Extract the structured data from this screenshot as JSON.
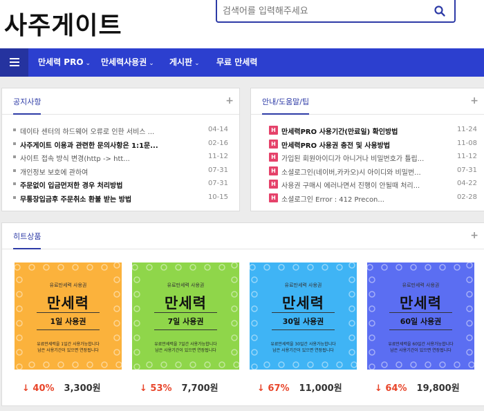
{
  "header": {
    "logo": "사주게이트",
    "search_placeholder": "검색어를 입력해주세요"
  },
  "nav": {
    "items": [
      {
        "label": "만세력 PRO",
        "chevron": "⌄"
      },
      {
        "label": "만세력사용권",
        "chevron": "⌄"
      },
      {
        "label": "게시판",
        "chevron": "⌄"
      },
      {
        "label": "무료 만세력",
        "chevron": ""
      }
    ]
  },
  "notice": {
    "title": "공지사항",
    "plus": "+",
    "items": [
      {
        "text": "데이타 센터의 하드웨어 오류로 인한 서비스 ...",
        "date": "04-14",
        "bold": false
      },
      {
        "text": "사주게이트 이용과 관련한 문의사항은 1:1문...",
        "date": "02-16",
        "bold": true
      },
      {
        "text": "사이트 접속 방식 변경(http -> htt...",
        "date": "11-12",
        "bold": false
      },
      {
        "text": "개인정보 보호에 관하여",
        "date": "07-31",
        "bold": false
      },
      {
        "text": "주문없이 입금먼저한 경우 처리방법",
        "date": "07-31",
        "bold": true
      },
      {
        "text": "무통장입금후 주문취소 환불 받는 방법",
        "date": "10-15",
        "bold": true
      }
    ]
  },
  "guide": {
    "title": "안내/도움말/팁",
    "plus": "+",
    "badge": "H",
    "items": [
      {
        "text": "만세력PRO 사용기간(만료일) 확인방법",
        "date": "11-24",
        "bold": true
      },
      {
        "text": "만세력PRO 사용권 충전 및 사용방법",
        "date": "11-08",
        "bold": true
      },
      {
        "text": "가입된 회원아이디가 아니거나 비밀번호가 틀립...",
        "date": "11-12",
        "bold": false
      },
      {
        "text": "소셜로그인(네이버,카카오)시 아이디와 비밀번...",
        "date": "07-31",
        "bold": false
      },
      {
        "text": "사용권 구매시 에러나면서 진행이 안될때 처리...",
        "date": "04-22",
        "bold": false
      },
      {
        "text": "소셜로그인 Error : 412 Precon...",
        "date": "02-28",
        "bold": false
      }
    ]
  },
  "hits": {
    "title": "히트상품",
    "plus": "+",
    "products": [
      {
        "top_label": "유료만세력 사용권",
        "title": "만세력",
        "days": "1일 사용권",
        "desc1": "유료만세력을 1일간 사용가능합니다",
        "desc2": "남은 사용기간이 있으면 연장됩니다",
        "discount": "↓ 40%",
        "price": "3,300원",
        "color": "#fbb23c"
      },
      {
        "top_label": "유료만세력 사용권",
        "title": "만세력",
        "days": "7일 사용권",
        "desc1": "유료만세력을 7일간 사용가능합니다",
        "desc2": "남은 사용기간이 있으면 연장됩니다",
        "discount": "↓ 53%",
        "price": "7,700원",
        "color": "#8fd64a"
      },
      {
        "top_label": "유료만세력 사용권",
        "title": "만세력",
        "days": "30일 사용권",
        "desc1": "유료만세력을 30일간 사용가능합니다",
        "desc2": "남은 사용기간이 있으면 연장됩니다",
        "discount": "↓ 67%",
        "price": "11,000원",
        "color": "#3fb4f5"
      },
      {
        "top_label": "유료만세력 사용권",
        "title": "만세력",
        "days": "60일 사용권",
        "desc1": "유료만세력을 60일간 사용가능합니다",
        "desc2": "남은 사용기간이 있으면 연장됩니다",
        "discount": "↓ 64%",
        "price": "19,800원",
        "color": "#5b6ef2"
      }
    ]
  }
}
